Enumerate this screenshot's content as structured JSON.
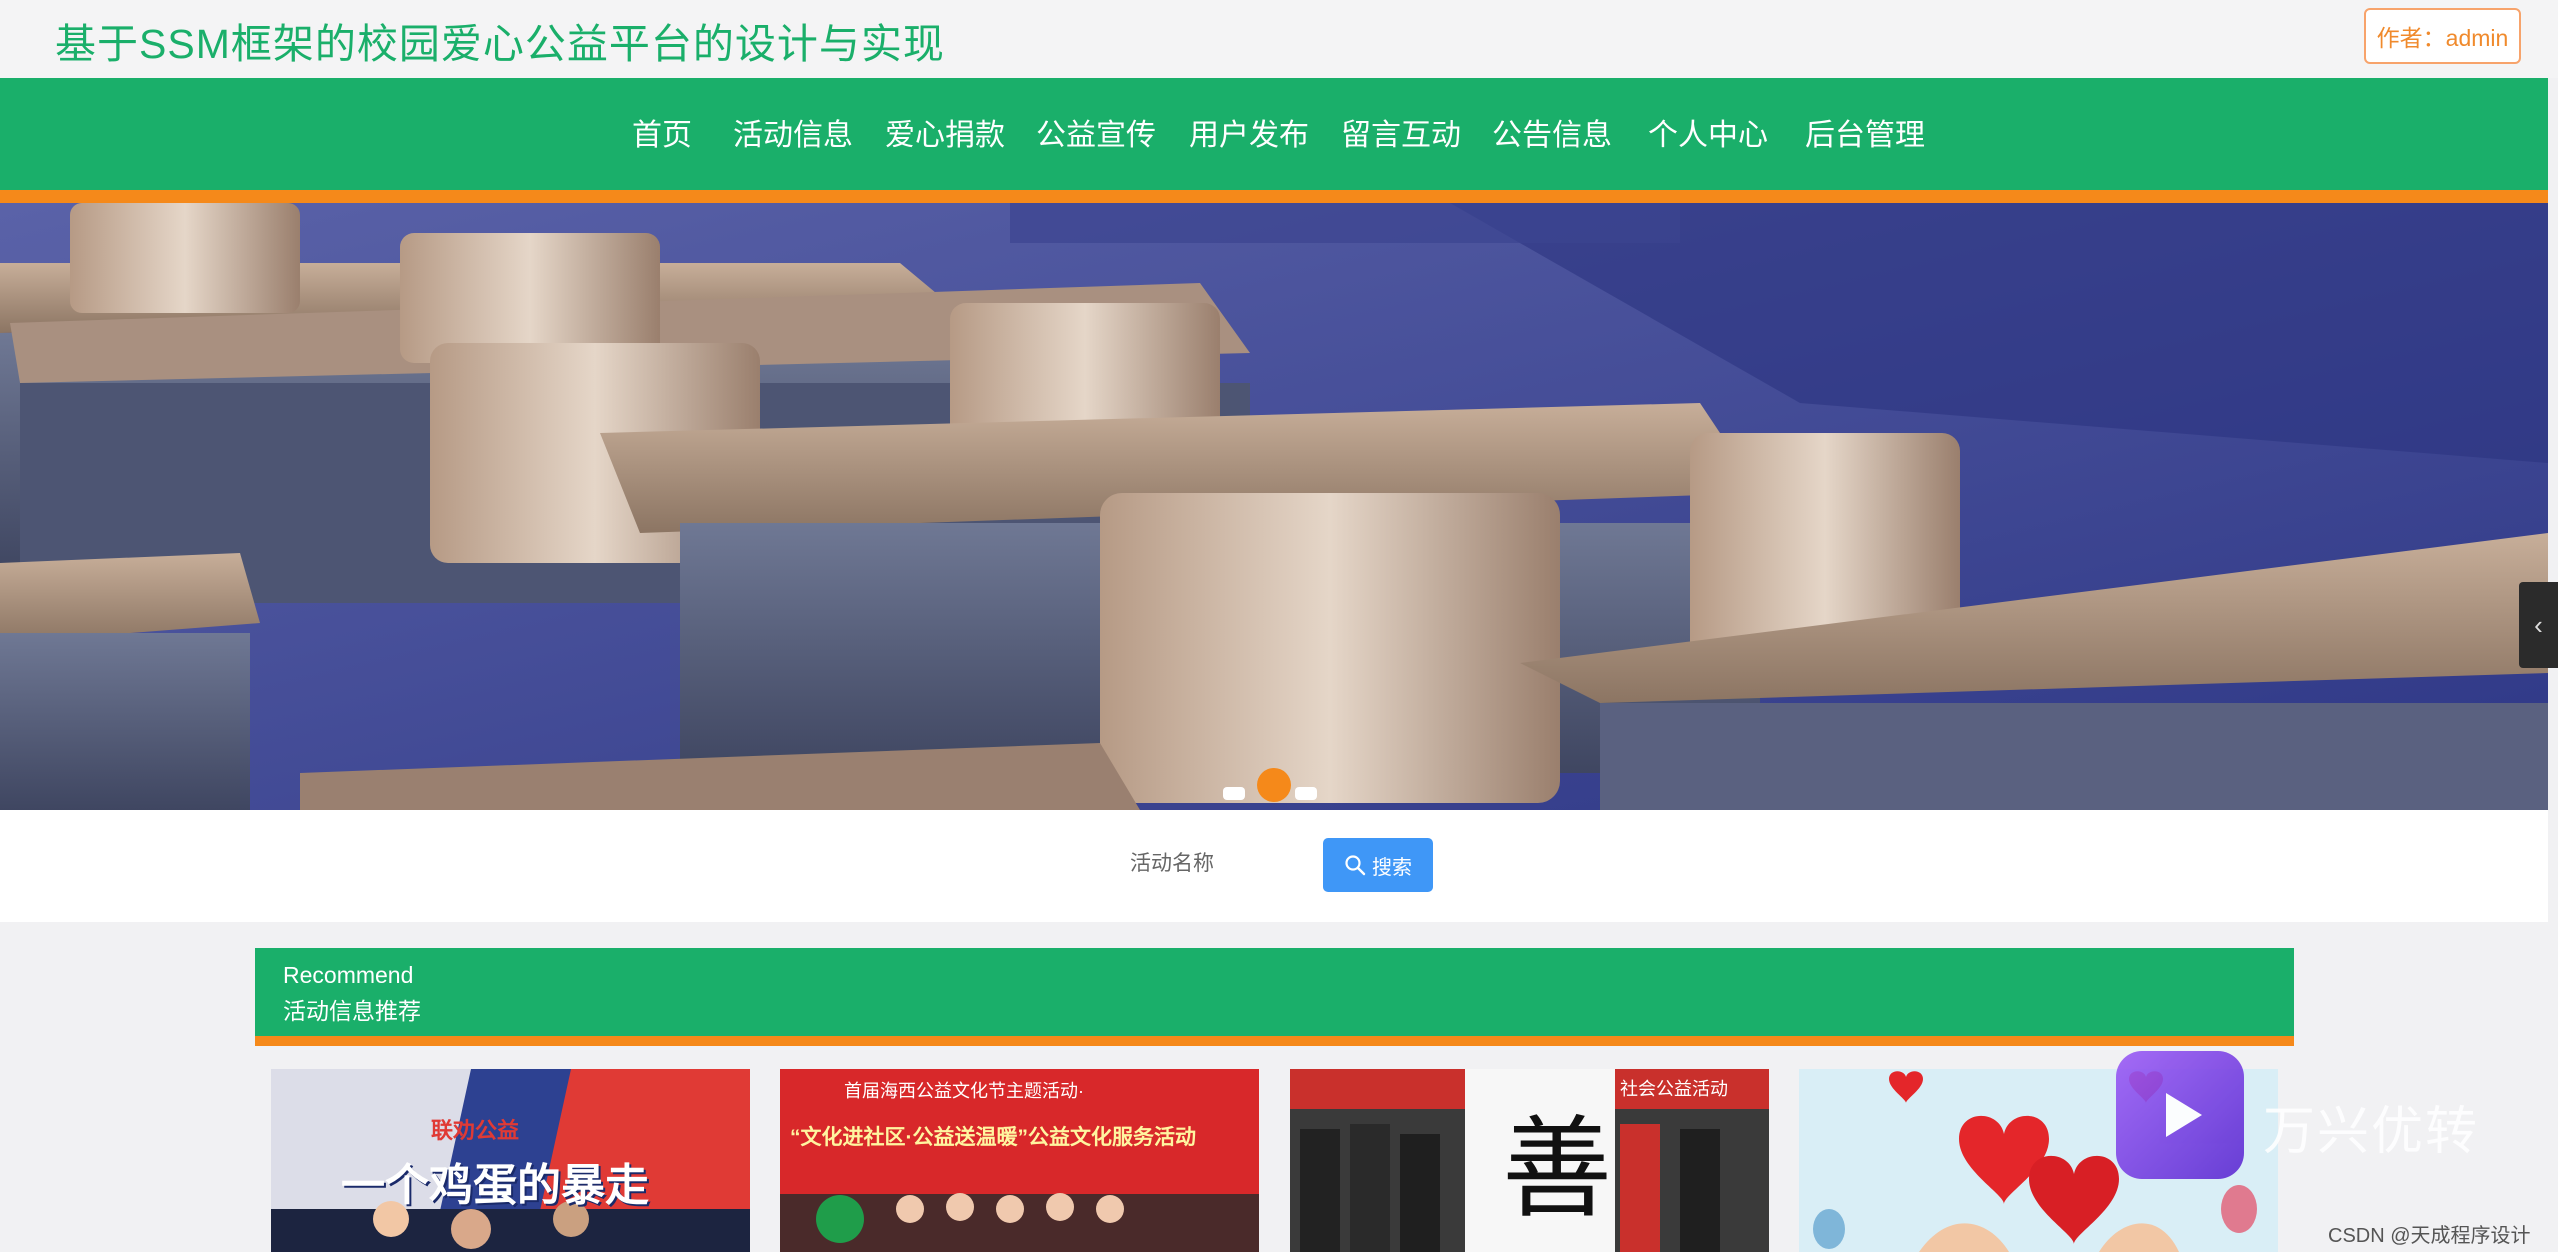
{
  "header": {
    "title": "基于SSM框架的校园爱心公益平台的设计与实现",
    "author_button": "作者：admin"
  },
  "nav": {
    "items": [
      "首页",
      "活动信息",
      "爱心捐款",
      "公益宣传",
      "用户发布",
      "留言互动",
      "公告信息",
      "个人中心",
      "后台管理"
    ]
  },
  "banner": {
    "slide_count": 3,
    "active_slide": 2
  },
  "search": {
    "label": "活动名称",
    "button_label": "搜索"
  },
  "recommend": {
    "title_en": "Recommend",
    "title_cn": "活动信息推荐",
    "cards": [
      {
        "caption": "一个鸡蛋的暴走",
        "logo_text": "联劝公益"
      },
      {
        "caption": "“文化进社区·公益送温暖”公益文化服务活动",
        "subcaption": "首届海西公益文化节主题活动·"
      },
      {
        "caption": "善",
        "subcaption": "社会公益活动"
      },
      {
        "caption": ""
      }
    ]
  },
  "watermark": {
    "text": "万兴优转",
    "credit": "CSDN @天成程序设计"
  },
  "colors": {
    "brand_green": "#1aaf6a",
    "accent_orange": "#f5891a",
    "search_blue": "#3f97f7"
  }
}
